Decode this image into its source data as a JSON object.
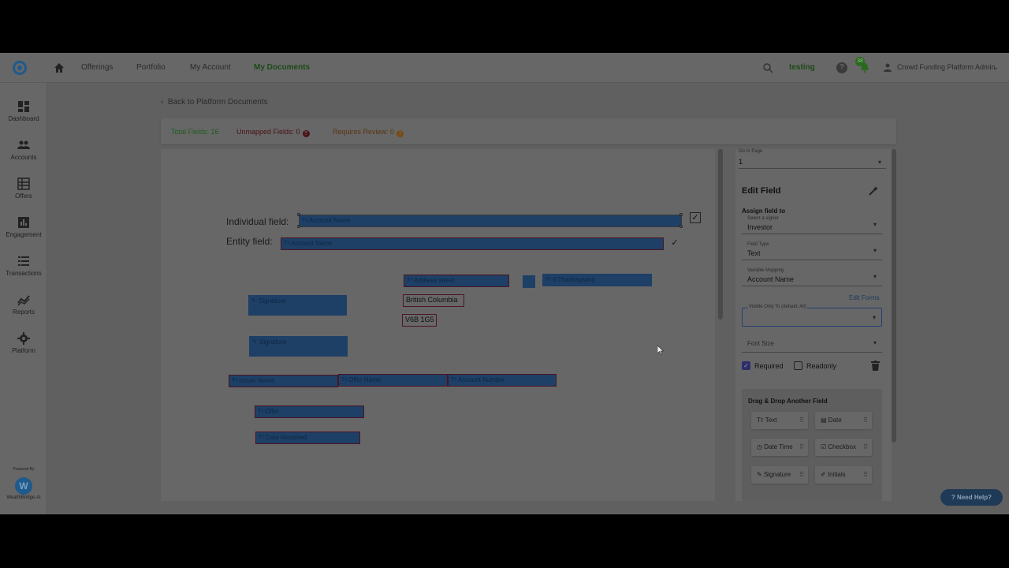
{
  "nav": {
    "links": [
      "Offerings",
      "Portfolio",
      "My Account",
      "My Documents"
    ],
    "tenant": "testing",
    "notif_count": "38",
    "user_name": "Crowd Funding Platform Admin"
  },
  "sidebar": {
    "items": [
      {
        "label": "Dashboard",
        "icon": "dashboard-icon"
      },
      {
        "label": "Accounts",
        "icon": "accounts-icon"
      },
      {
        "label": "Offers",
        "icon": "offers-icon"
      },
      {
        "label": "Engagement",
        "icon": "engagement-icon"
      },
      {
        "label": "Transactions",
        "icon": "transactions-icon"
      },
      {
        "label": "Reports",
        "icon": "reports-icon"
      },
      {
        "label": "Platform",
        "icon": "gear-icon"
      }
    ],
    "powered_by": "Powered By",
    "brand": "WealthBridge.AI"
  },
  "main": {
    "back_label": "Back to Platform Documents",
    "stats": {
      "total": "Total Fields: 16",
      "unmapped": "Unmapped Fields: 0",
      "review": "Requires Review: 0"
    }
  },
  "document": {
    "individual_label": "Individual field:",
    "entity_label": "Entity field:",
    "fields": {
      "account_name_1": "Account Name",
      "account_name_2": "Account Name",
      "address_street": "Address street",
      "holiday": "If Thanksgiving",
      "province": "British Columbia",
      "postal": "V6B 1G5",
      "signature_1": "Signature",
      "signature_2": "Signature",
      "issuer_name": "Issuer Name",
      "offer_name": "Offer Name",
      "account_number": "Account Number",
      "offer": "Offer",
      "date_received": "Date Received"
    }
  },
  "panel": {
    "goto_label": "Go to Page",
    "goto_value": "1",
    "title": "Edit Field",
    "assign_label": "Assign field to",
    "signer": {
      "label": "Select a signer",
      "value": "Investor"
    },
    "field_type": {
      "label": "Field Type",
      "value": "Text"
    },
    "mapping": {
      "label": "Variable Mapping",
      "value": "Account Name"
    },
    "edit_forms": "Edit Forms",
    "visible_only": {
      "label": "Visible Only To (default: All)",
      "value": ""
    },
    "font_size": {
      "label": "Font Size"
    },
    "required": "Required",
    "readonly": "Readonly",
    "dd_title": "Drag & Drop Another Field",
    "chips": [
      "Text",
      "Date",
      "Date Time",
      "Checkbox",
      "Signature",
      "Initials"
    ]
  },
  "help_button": "Need Help?",
  "colors": {
    "field_fill": "#1e3f66",
    "field_border": "#4d1422",
    "total_green": "#1f5a1f",
    "unmapped_red": "#4a1216",
    "review_orange": "#5a3510",
    "overlay": "#606060"
  }
}
